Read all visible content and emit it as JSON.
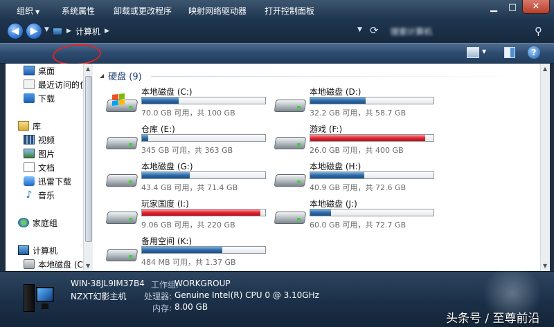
{
  "window": {
    "minimize_icon": "minimize-icon",
    "maximize_icon": "maximize-icon",
    "close_icon": "close-icon"
  },
  "address": {
    "crumb": "计算机",
    "search_placeholder": "搜索计算机"
  },
  "toolbar": {
    "organize": "组织",
    "system_properties": "系统属性",
    "uninstall": "卸载或更改程序",
    "map_drive": "映射网络驱动器",
    "control_panel": "打开控制面板"
  },
  "sidebar": {
    "items": [
      {
        "label": "桌面",
        "icon": "desktop-icon"
      },
      {
        "label": "最近访问的位置",
        "icon": "recent-places-icon"
      },
      {
        "label": "下载",
        "icon": "downloads-icon"
      },
      {
        "label": "库",
        "icon": "libraries-icon"
      },
      {
        "label": "视频",
        "icon": "videos-icon"
      },
      {
        "label": "图片",
        "icon": "pictures-icon"
      },
      {
        "label": "文档",
        "icon": "documents-icon"
      },
      {
        "label": "迅雷下载",
        "icon": "xunlei-icon"
      },
      {
        "label": "音乐",
        "icon": "music-icon"
      },
      {
        "label": "家庭组",
        "icon": "homegroup-icon"
      },
      {
        "label": "计算机",
        "icon": "computer-icon"
      },
      {
        "label": "本地磁盘 (C:)",
        "icon": "drive-icon"
      }
    ]
  },
  "content": {
    "group_title": "硬盘 (9)",
    "drives": [
      {
        "name": "本地磁盘 (C:)",
        "capacity": "70.0 GB 可用，共 100 GB",
        "used_fraction": 0.3,
        "full": false,
        "system": true
      },
      {
        "name": "本地磁盘 (D:)",
        "capacity": "32.2 GB 可用，共 58.7 GB",
        "used_fraction": 0.45,
        "full": false,
        "system": false
      },
      {
        "name": "仓库 (E:)",
        "capacity": "345 GB 可用，共 363 GB",
        "used_fraction": 0.05,
        "full": false,
        "system": false
      },
      {
        "name": "游戏 (F:)",
        "capacity": "26.0 GB 可用，共 400 GB",
        "used_fraction": 0.935,
        "full": true,
        "system": false
      },
      {
        "name": "本地磁盘 (G:)",
        "capacity": "43.4 GB 可用，共 71.4 GB",
        "used_fraction": 0.39,
        "full": false,
        "system": false
      },
      {
        "name": "本地磁盘 (H:)",
        "capacity": "40.9 GB 可用，共 72.6 GB",
        "used_fraction": 0.44,
        "full": false,
        "system": false
      },
      {
        "name": "玩家国度 (I:)",
        "capacity": "9.06 GB 可用，共 220 GB",
        "used_fraction": 0.96,
        "full": true,
        "system": false
      },
      {
        "name": "本地磁盘 (J:)",
        "capacity": "60.0 GB 可用，共 72.7 GB",
        "used_fraction": 0.17,
        "full": false,
        "system": false
      },
      {
        "name": "备用空间 (K:)",
        "capacity": "484 MB 可用，共 1.37 GB",
        "used_fraction": 0.65,
        "full": false,
        "system": false
      }
    ]
  },
  "details": {
    "computer_name": "WIN-38JL9IM37B4",
    "workgroup_label": "工作组:",
    "workgroup": "WORKGROUP",
    "description": "NZXT幻影主机",
    "processor_label": "处理器:",
    "processor": "Genuine Intel(R) CPU 0 @ 3.10GHz",
    "memory_label": "内存:",
    "memory": "8.00 GB"
  },
  "watermark": "头条号 / 至尊前沿",
  "colors": {
    "normal_bar": "#2f6aa6",
    "full_bar": "#e0262f",
    "annotation_ring": "#e0242c"
  }
}
